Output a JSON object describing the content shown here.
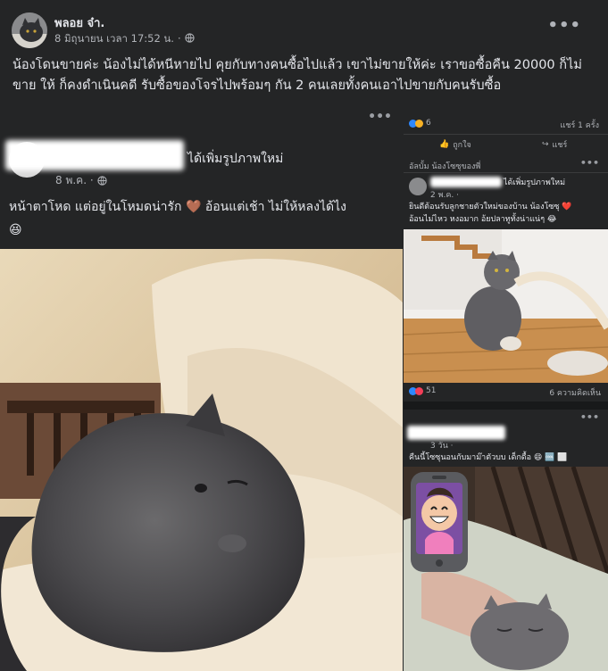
{
  "post": {
    "author": "พลอย จ๋า.",
    "date": "8 มิถุนายน เวลา 17:52 น.",
    "dot": "·",
    "privacy_icon": "globe-icon",
    "more_icon": "more-horizontal-icon",
    "body": "น้องโดนขายค่ะ น้องไม่ได้หนีหายไป คุยกับทางคนซื้อไปแล้ว เขาไม่ขายให้ค่ะ เราขอซื้อคืน 20000 ก็ไม่ขาย ให้ ก็คงดำเนินคดี รับซื้อของโจรไปพร้อมๆ กัน 2 คนเลยทั้งคนเอาไปขายกับคนรับซื้อ"
  },
  "left_screenshot": {
    "action_text": "ได้เพิ่มรูปภาพใหม่",
    "date": "8 พ.ค. ·",
    "caption_line1": "หน้าตาโหด แต่อยู่ในโหมดน่ารัก 🤎 อ้อนแต่เช้า ไม่ให้หลงได้ไง",
    "caption_line2": "😆"
  },
  "right_screenshot": {
    "top_card": {
      "reactions_count": "6",
      "shares": "แชร์ 1 ครั้ง",
      "like_label": "ถูกใจ",
      "share_label": "แชร์"
    },
    "middle_card": {
      "header": "อัลบั้ม น้องโซซุของพี่",
      "action_text": "ได้เพิ่มรูปภาพใหม่",
      "date": "2 พ.ค. ·",
      "caption_line1": "ยินดีต้อนรับลูกชายตัวใหม่ของบ้าน น้องโซซุ ❤️",
      "caption_line2": "อ้อนไม่ไหว หงอมาก อ้ยปลาทูทั้งน่าแน่ๆ 😂",
      "reactions_count": "51",
      "comments": "6 ความคิดเห็น"
    },
    "bottom_card": {
      "date": "3 วัน ·",
      "caption": "คืนนี้โซซุนอนกับมาม๊าตัวบบ เด็กดื้อ 😄 🆒 ⬜"
    }
  },
  "colors": {
    "background": "#242526",
    "text_primary": "#e4e6eb",
    "text_secondary": "#b0b3b8",
    "like_blue": "#2d88ff",
    "love_red": "#f33e58",
    "haha_yellow": "#f7b125"
  }
}
